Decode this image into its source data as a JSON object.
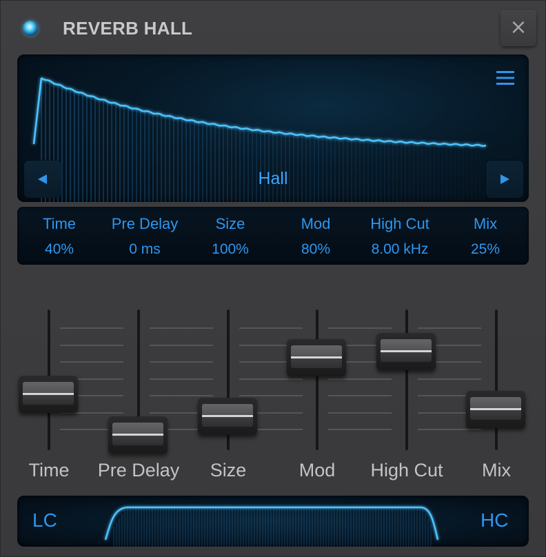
{
  "header": {
    "title": "REVERB HALL",
    "close_label": "×",
    "power_icon": "power-led-icon"
  },
  "colors": {
    "accent": "#2f96ee",
    "display_bg": "#061826",
    "panel_bg": "#3c3c3e",
    "label": "#c3c3c3"
  },
  "display": {
    "preset_name": "Hall",
    "menu_icon": "hamburger-menu-icon",
    "prev_icon": "triangle-left-icon",
    "next_icon": "triangle-right-icon"
  },
  "readout": [
    {
      "name": "Time",
      "value": "40%"
    },
    {
      "name": "Pre Delay",
      "value": "0 ms"
    },
    {
      "name": "Size",
      "value": "100%"
    },
    {
      "name": "Mod",
      "value": "80%"
    },
    {
      "name": "High Cut",
      "value": "8.00 kHz"
    },
    {
      "name": "Mix",
      "value": "25%"
    }
  ],
  "faders": [
    {
      "label": "Time",
      "level": 0.45
    },
    {
      "label": "Pre Delay",
      "level": 0.1
    },
    {
      "label": "Size",
      "level": 0.26
    },
    {
      "label": "Mod",
      "level": 0.76
    },
    {
      "label": "High Cut",
      "level": 0.81
    },
    {
      "label": "Mix",
      "level": 0.32
    }
  ],
  "filter": {
    "low_cut_label": "LC",
    "high_cut_label": "HC"
  }
}
